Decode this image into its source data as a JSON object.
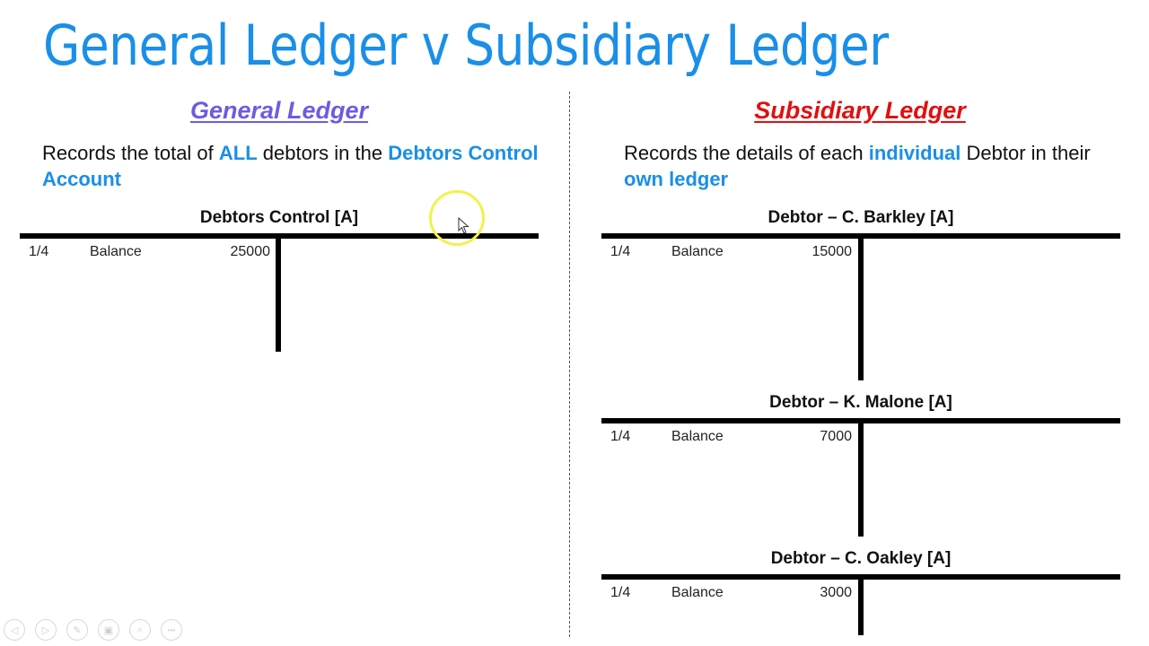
{
  "slide": {
    "title": "General Ledger v Subsidiary Ledger",
    "colors": {
      "title": "#1a8fe8",
      "highlight": "#1a8fe8",
      "general_heading": "#6a5de0",
      "subsidiary_heading": "#e01010"
    }
  },
  "general": {
    "heading": "General Ledger",
    "description": {
      "p1": "Records the total of ",
      "h1": "ALL",
      "p2": " debtors in the ",
      "h2": "Debtors Control Account"
    },
    "account": {
      "title": "Debtors Control [A]",
      "rows": [
        {
          "date": "1/4",
          "description": "Balance",
          "amount": "25000"
        }
      ]
    }
  },
  "subsidiary": {
    "heading": "Subsidiary Ledger",
    "description": {
      "p1": "Records the details of each ",
      "h1": "individual",
      "p2": " Debtor in their ",
      "h2": "own ledger"
    },
    "accounts": [
      {
        "title": "Debtor – C. Barkley [A]",
        "rows": [
          {
            "date": "1/4",
            "description": "Balance",
            "amount": "15000"
          }
        ]
      },
      {
        "title": "Debtor – K. Malone [A]",
        "rows": [
          {
            "date": "1/4",
            "description": "Balance",
            "amount": "7000"
          }
        ]
      },
      {
        "title": "Debtor – C. Oakley [A]",
        "rows": [
          {
            "date": "1/4",
            "description": "Balance",
            "amount": "3000"
          }
        ]
      }
    ]
  },
  "toolbar": {
    "buttons": [
      {
        "name": "previous-slide",
        "icon": "◁"
      },
      {
        "name": "next-slide",
        "icon": "▷"
      },
      {
        "name": "pen",
        "icon": "✎"
      },
      {
        "name": "slides-view",
        "icon": "▣"
      },
      {
        "name": "zoom",
        "icon": "⌕"
      },
      {
        "name": "more-options",
        "icon": "•••"
      }
    ]
  }
}
